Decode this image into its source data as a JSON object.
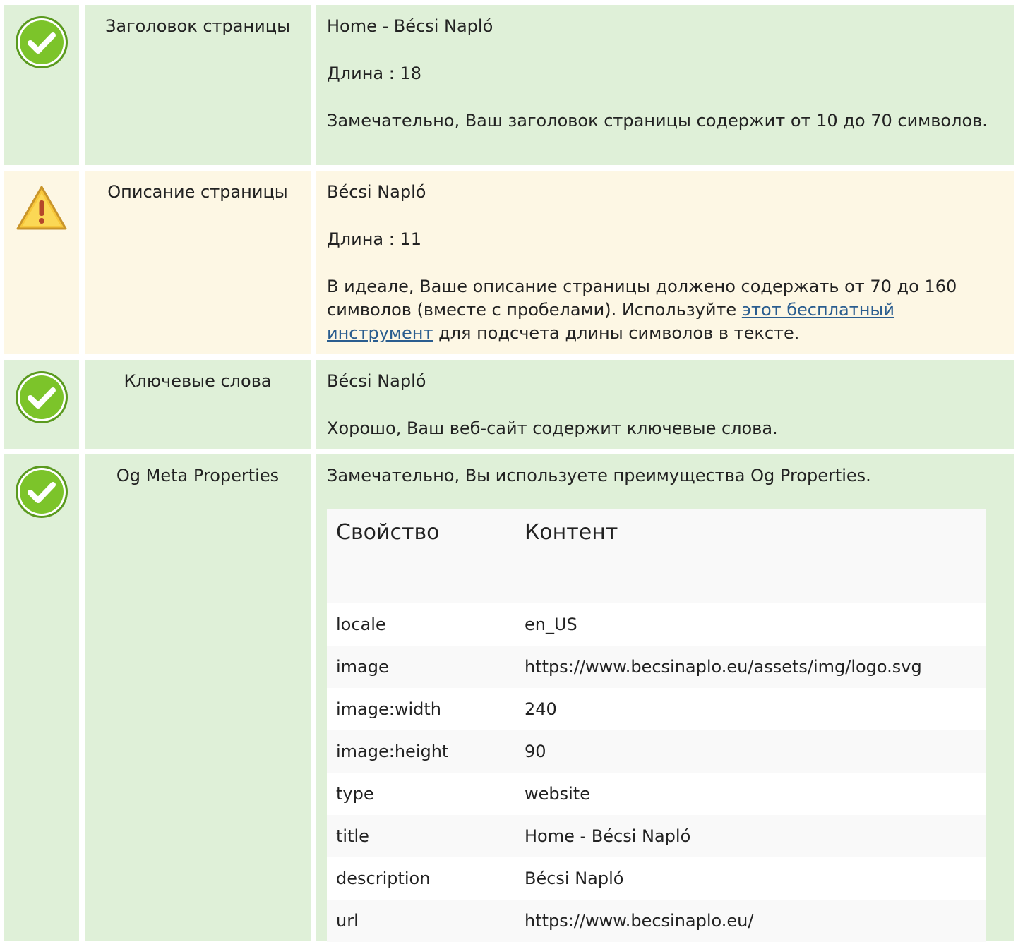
{
  "rows": [
    {
      "status": "good",
      "label": "Заголовок страницы",
      "value": "Home - Bécsi Napló",
      "length_line": "Длина : 18",
      "message": "Замечательно, Ваш заголовок страницы содержит от 10 до 70 символов."
    },
    {
      "status": "warning",
      "label": "Описание страницы",
      "value": "Bécsi Napló",
      "length_line": "Длина : 11",
      "message_before": "В идеале, Ваше описание страницы должено содержать от 70 до 160 символов (вместе с пробелами). Используйте ",
      "link_text": "этот бесплатный инструмент",
      "message_after": " для подсчета длины символов в тексте."
    },
    {
      "status": "good",
      "label": "Ключевые слова",
      "value": "Bécsi Napló",
      "message": "Хорошо, Ваш веб-сайт содержит ключевые слова."
    },
    {
      "status": "good",
      "label": "Og Meta Properties",
      "message": "Замечательно, Вы используете преимущества Og Properties.",
      "table": {
        "headers": [
          "Свойство",
          "Контент"
        ],
        "rows": [
          [
            "locale",
            "en_US"
          ],
          [
            "image",
            "https://www.becsinaplo.eu/assets/img/logo.svg"
          ],
          [
            "image:width",
            "240"
          ],
          [
            "image:height",
            "90"
          ],
          [
            "type",
            "website"
          ],
          [
            "title",
            "Home - Bécsi Napló"
          ],
          [
            "description",
            "Bécsi Napló"
          ],
          [
            "url",
            "https://www.becsinaplo.eu/"
          ]
        ]
      }
    }
  ],
  "icons": {
    "good": "check-circle-icon",
    "warning": "warning-triangle-icon"
  },
  "colors": {
    "good_bg": "#dff0d8",
    "warning_bg": "#fdf7e4",
    "link": "#2a5d8f",
    "check_green": "#7cc42a",
    "warning_yellow": "#f7c73b"
  }
}
